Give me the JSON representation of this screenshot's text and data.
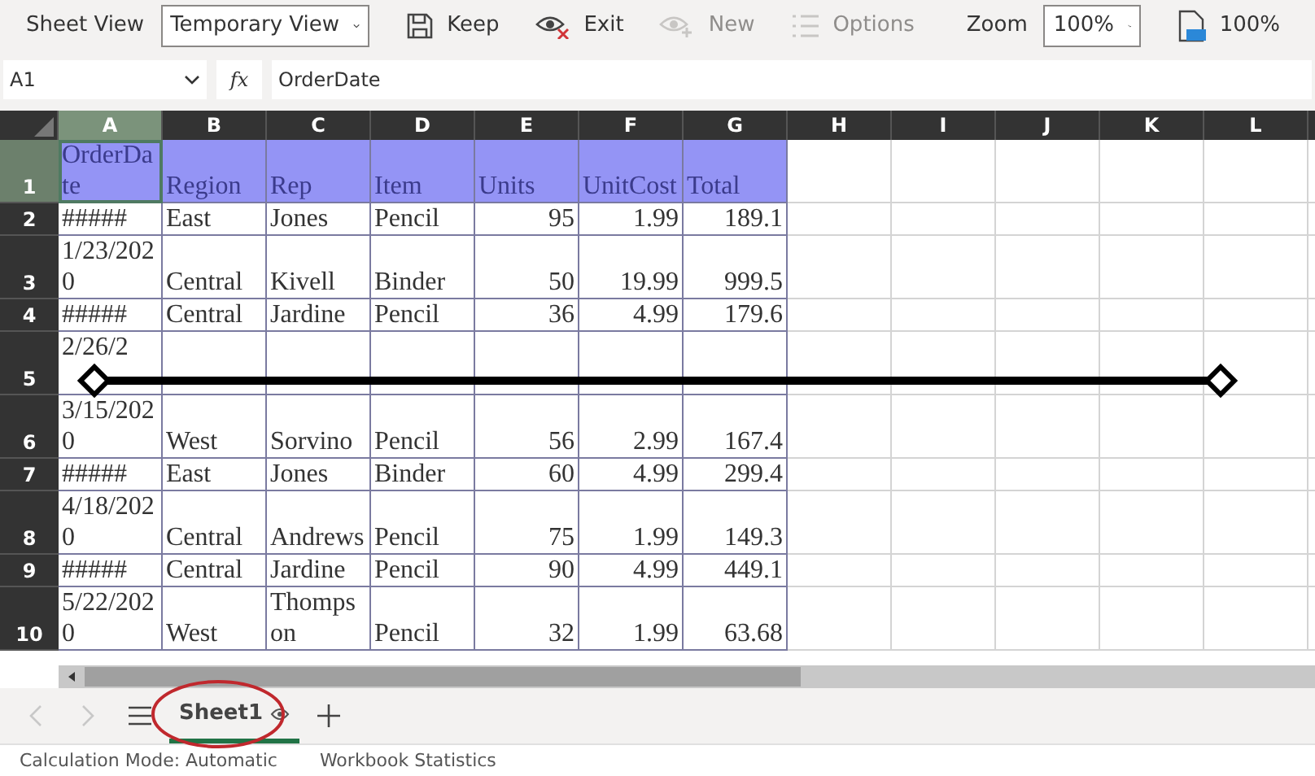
{
  "toolbar": {
    "sheet_view_label": "Sheet View",
    "view_select": {
      "value": "Temporary View"
    },
    "buttons": [
      {
        "kind": "keep",
        "label": "Keep",
        "disabled": false
      },
      {
        "kind": "exit",
        "label": "Exit",
        "disabled": false
      },
      {
        "kind": "new",
        "label": "New",
        "disabled": true
      },
      {
        "kind": "options",
        "label": "Options",
        "disabled": true
      }
    ],
    "zoom_label": "Zoom",
    "zoom_select": {
      "value": "100%"
    },
    "zoom_reset": {
      "label": "100%"
    }
  },
  "formula_bar": {
    "name_box": "A1",
    "fx": "fx",
    "formula": "OrderDate"
  },
  "sheet": {
    "columns": [
      {
        "label": "A",
        "selected": true,
        "kind": "text"
      },
      {
        "label": "B",
        "selected": false,
        "kind": "text"
      },
      {
        "label": "C",
        "selected": false,
        "kind": "text"
      },
      {
        "label": "D",
        "selected": false,
        "kind": "text"
      },
      {
        "label": "E",
        "selected": false,
        "kind": "number"
      },
      {
        "label": "F",
        "selected": false,
        "kind": "number"
      },
      {
        "label": "G",
        "selected": false,
        "kind": "number"
      },
      {
        "label": "H",
        "selected": false,
        "kind": "empty"
      },
      {
        "label": "I",
        "selected": false,
        "kind": "empty"
      },
      {
        "label": "J",
        "selected": false,
        "kind": "empty"
      },
      {
        "label": "K",
        "selected": false,
        "kind": "empty"
      },
      {
        "label": "L",
        "selected": false,
        "kind": "empty"
      }
    ],
    "rows": [
      {
        "number": "1",
        "selected": true,
        "header": true,
        "cells": [
          "OrderDate",
          "Region",
          "Rep",
          "Item",
          "Units",
          "UnitCost",
          "Total"
        ]
      },
      {
        "number": "2",
        "selected": false,
        "header": false,
        "cells": [
          "#####",
          "East",
          "Jones",
          "Pencil",
          "95",
          "1.99",
          "189.1"
        ]
      },
      {
        "number": "3",
        "selected": false,
        "header": false,
        "cells": [
          "1/23/2020",
          "Central",
          "Kivell",
          "Binder",
          "50",
          "19.99",
          "999.5"
        ]
      },
      {
        "number": "4",
        "selected": false,
        "header": false,
        "cells": [
          "#####",
          "Central",
          "Jardine",
          "Pencil",
          "36",
          "4.99",
          "179.6"
        ]
      },
      {
        "number": "5",
        "selected": false,
        "header": false,
        "kind": "covered",
        "cells": [
          "2/26/2",
          null,
          null,
          null,
          null,
          null,
          null
        ]
      },
      {
        "number": "6",
        "selected": false,
        "header": false,
        "cells": [
          "3/15/2020",
          "West",
          "Sorvino",
          "Pencil",
          "56",
          "2.99",
          "167.4"
        ]
      },
      {
        "number": "7",
        "selected": false,
        "header": false,
        "cells": [
          "#####",
          "East",
          "Jones",
          "Binder",
          "60",
          "4.99",
          "299.4"
        ]
      },
      {
        "number": "8",
        "selected": false,
        "header": false,
        "cells": [
          "4/18/2020",
          "Central",
          "Andrews",
          "Pencil",
          "75",
          "1.99",
          "149.3"
        ]
      },
      {
        "number": "9",
        "selected": false,
        "header": false,
        "cells": [
          "#####",
          "Central",
          "Jardine",
          "Pencil",
          "90",
          "4.99",
          "449.1"
        ]
      },
      {
        "number": "10",
        "selected": false,
        "header": false,
        "cells": [
          "5/22/2020",
          "West",
          "Thompson",
          "Pencil",
          "32",
          "1.99",
          "63.68"
        ]
      }
    ]
  },
  "sheet_tabs": {
    "tabs": [
      {
        "label": "Sheet1",
        "selected": true
      }
    ]
  },
  "status_bar": {
    "items": [
      "Calculation Mode: Automatic",
      "Workbook Statistics"
    ]
  }
}
